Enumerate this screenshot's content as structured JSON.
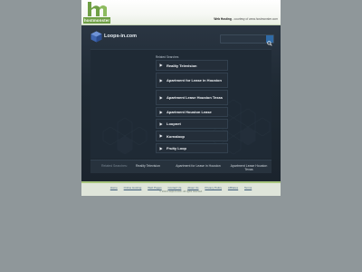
{
  "host": {
    "logo_text": "hostmonster",
    "note_bold": "Web Hosting",
    "note_rest": " - courtesy of www.hostmonster.com"
  },
  "site": {
    "name": "Loops-in.com",
    "search_placeholder": ""
  },
  "related": {
    "title": "Related Searches",
    "items": [
      {
        "label": "Reality Television"
      },
      {
        "label": "Apartment for Lease in Houston"
      },
      {
        "label": "Apartment Lease Houston Texas"
      },
      {
        "label": "Apartment Houston Lease"
      },
      {
        "label": "Loopnet"
      },
      {
        "label": "Kornaloop"
      },
      {
        "label": "Fruity Loop"
      }
    ]
  },
  "bottom": {
    "label": "Related Searches:",
    "links": [
      "Reality Television",
      "Apartment for Lease in Houston",
      "Apartment Lease Houston Texas"
    ]
  },
  "footer": {
    "links": [
      "Home",
      "Online Hosting",
      "Web Pages",
      "Contact Us",
      "About Us",
      "Privacy Policy",
      "Affiliates",
      "Terms"
    ],
    "copyright": "© 2013 Loops-in.com. All rights reserved."
  },
  "colors": {
    "page_bg": "#8f979a",
    "panel": "#1e2831",
    "accent_green": "#6f9f45",
    "search_button": "#2f6aa6"
  }
}
